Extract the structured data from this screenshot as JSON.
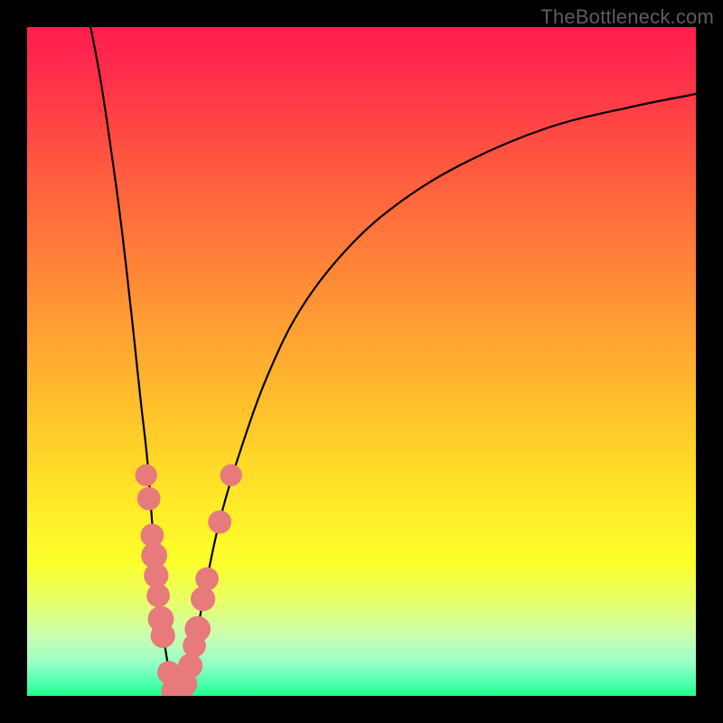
{
  "watermark": "TheBottleneck.com",
  "colors": {
    "curve_stroke": "#000000",
    "marker_fill": "#e77a7a",
    "marker_stroke": "#d86b6b"
  },
  "chart_data": {
    "type": "line",
    "title": "",
    "xlabel": "",
    "ylabel": "",
    "x_range": [
      0,
      100
    ],
    "y_range": [
      0,
      100
    ],
    "notes": "V-shaped bottleneck curve. x ~ relative component score, y ~ bottleneck (100 = severe, 0 = none). Minimum near x≈22.",
    "curve_points": [
      {
        "x": 9.5,
        "y": 100.0
      },
      {
        "x": 11.0,
        "y": 92.0
      },
      {
        "x": 12.5,
        "y": 82.0
      },
      {
        "x": 14.0,
        "y": 71.0
      },
      {
        "x": 15.5,
        "y": 58.0
      },
      {
        "x": 17.0,
        "y": 44.0
      },
      {
        "x": 18.0,
        "y": 35.0
      },
      {
        "x": 19.0,
        "y": 22.0
      },
      {
        "x": 20.0,
        "y": 12.0
      },
      {
        "x": 21.0,
        "y": 5.0
      },
      {
        "x": 22.0,
        "y": 0.5
      },
      {
        "x": 23.0,
        "y": 0.5
      },
      {
        "x": 24.0,
        "y": 3.0
      },
      {
        "x": 25.5,
        "y": 10.0
      },
      {
        "x": 27.0,
        "y": 18.0
      },
      {
        "x": 29.0,
        "y": 27.0
      },
      {
        "x": 32.0,
        "y": 37.0
      },
      {
        "x": 36.0,
        "y": 48.0
      },
      {
        "x": 41.0,
        "y": 58.0
      },
      {
        "x": 48.0,
        "y": 67.0
      },
      {
        "x": 56.0,
        "y": 74.0
      },
      {
        "x": 66.0,
        "y": 80.0
      },
      {
        "x": 78.0,
        "y": 85.0
      },
      {
        "x": 90.0,
        "y": 88.0
      },
      {
        "x": 100.0,
        "y": 90.0
      }
    ],
    "markers": [
      {
        "x": 17.8,
        "y": 33.0,
        "r": 1.1
      },
      {
        "x": 18.2,
        "y": 29.5,
        "r": 1.2
      },
      {
        "x": 18.7,
        "y": 24.0,
        "r": 1.2
      },
      {
        "x": 19.0,
        "y": 21.0,
        "r": 1.4
      },
      {
        "x": 19.3,
        "y": 18.0,
        "r": 1.3
      },
      {
        "x": 19.6,
        "y": 15.0,
        "r": 1.2
      },
      {
        "x": 20.0,
        "y": 11.5,
        "r": 1.4
      },
      {
        "x": 20.3,
        "y": 9.0,
        "r": 1.3
      },
      {
        "x": 21.2,
        "y": 3.5,
        "r": 1.2
      },
      {
        "x": 22.0,
        "y": 0.7,
        "r": 1.4
      },
      {
        "x": 22.9,
        "y": 0.7,
        "r": 1.4
      },
      {
        "x": 23.7,
        "y": 1.8,
        "r": 1.2
      },
      {
        "x": 24.4,
        "y": 4.5,
        "r": 1.3
      },
      {
        "x": 25.0,
        "y": 7.5,
        "r": 1.2
      },
      {
        "x": 25.5,
        "y": 10.0,
        "r": 1.4
      },
      {
        "x": 26.3,
        "y": 14.5,
        "r": 1.3
      },
      {
        "x": 26.9,
        "y": 17.5,
        "r": 1.2
      },
      {
        "x": 28.8,
        "y": 26.0,
        "r": 1.2
      },
      {
        "x": 30.5,
        "y": 33.0,
        "r": 1.1
      }
    ]
  }
}
